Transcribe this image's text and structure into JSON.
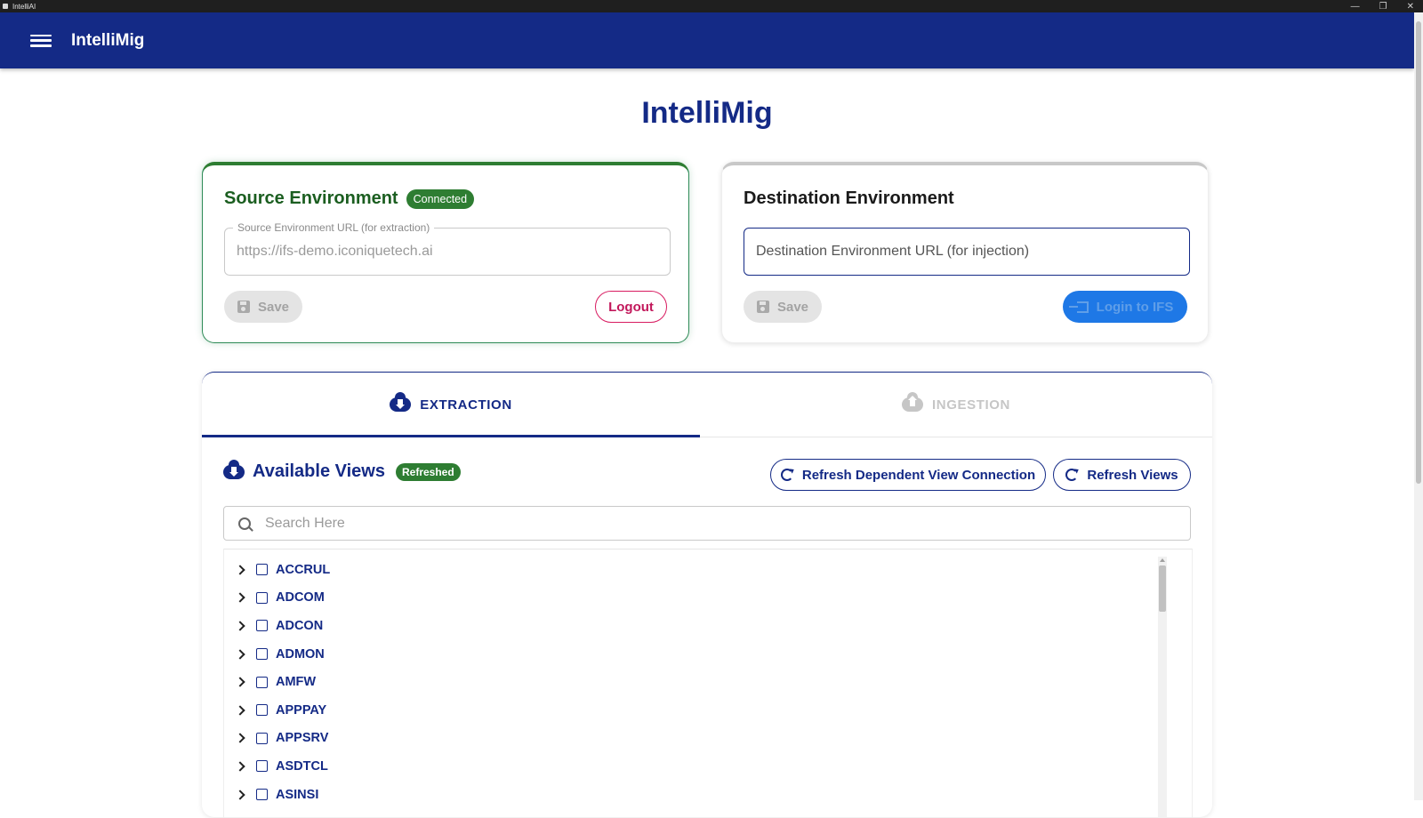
{
  "window": {
    "title": "IntelliAI",
    "controls": [
      "—",
      "❐",
      "✕"
    ]
  },
  "app_bar": {
    "title": "IntelliMig"
  },
  "page": {
    "title": "IntelliMig"
  },
  "source_env": {
    "title": "Source Environment",
    "status": "Connected",
    "url_label": "Source Environment URL (for extraction)",
    "url_value": "https://ifs-demo.iconiquetech.ai",
    "save_label": "Save",
    "logout_label": "Logout"
  },
  "dest_env": {
    "title": "Destination Environment",
    "url_placeholder": "Destination Environment URL (for injection)",
    "save_label": "Save",
    "login_label": "Login to IFS"
  },
  "tabs": [
    {
      "label": "EXTRACTION",
      "icon": "cloud-download-icon",
      "active": true
    },
    {
      "label": "INGESTION",
      "icon": "cloud-upload-icon",
      "active": false
    }
  ],
  "views": {
    "title": "Available Views",
    "status": "Refreshed",
    "refresh_dependent_label": "Refresh Dependent View Connection",
    "refresh_views_label": "Refresh Views",
    "search_placeholder": "Search Here",
    "items": [
      "ACCRUL",
      "ADCOM",
      "ADCON",
      "ADMON",
      "AMFW",
      "APPPAY",
      "APPSRV",
      "ASDTCL",
      "ASINSI"
    ]
  },
  "colors": {
    "primary": "#142a86",
    "success": "#2e7d32",
    "logout": "#c2185b",
    "login": "#1e78e6"
  }
}
